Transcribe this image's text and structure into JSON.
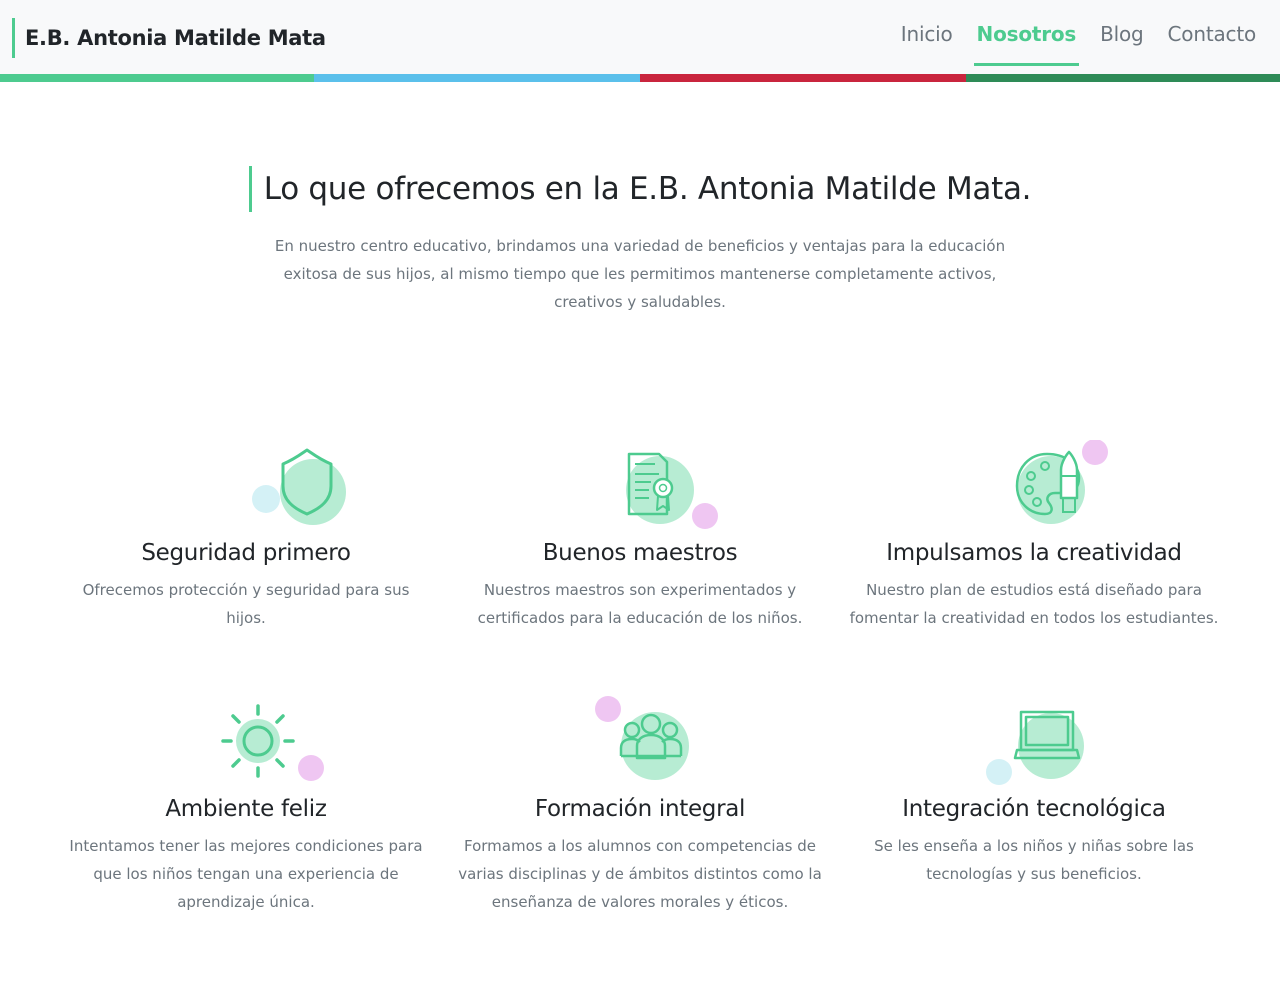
{
  "navbar": {
    "brand": "E.B. Antonia Matilde Mata",
    "links": [
      {
        "label": "Inicio",
        "active": false
      },
      {
        "label": "Nosotros",
        "active": true
      },
      {
        "label": "Blog",
        "active": false
      },
      {
        "label": "Contacto",
        "active": false
      }
    ]
  },
  "colors": {
    "accent": "#4dcb8f",
    "bar": [
      "#4dcb8f",
      "#5bc0eb",
      "#c9253d",
      "#2e8b57"
    ],
    "circle_green": "#b7ecd3",
    "circle_pink": "#efc6f2",
    "circle_blue": "#d4f1f6"
  },
  "section": {
    "title": "Lo que ofrecemos en la E.B. Antonia Matilde Mata.",
    "intro": "En nuestro centro educativo, brindamos una variedad de beneficios y ventajas para la educación exitosa de sus hijos, al mismo tiempo que les permitimos mantenerse completamente activos, creativos y saludables."
  },
  "features": [
    {
      "icon": "shield-icon",
      "title": "Seguridad primero",
      "text": "Ofrecemos protección y seguridad para sus hijos."
    },
    {
      "icon": "certificate-icon",
      "title": "Buenos maestros",
      "text": "Nuestros maestros son experimentados y certificados para la educación de los niños."
    },
    {
      "icon": "palette-icon",
      "title": "Impulsamos la creatividad",
      "text": "Nuestro plan de estudios está diseñado para fomentar la creatividad en todos los estudiantes."
    },
    {
      "icon": "sun-icon",
      "title": "Ambiente feliz",
      "text": "Intentamos tener las mejores condiciones para que los niños tengan una experiencia de aprendizaje única."
    },
    {
      "icon": "group-icon",
      "title": "Formación integral",
      "text": "Formamos a los alumnos con competencias de varias disciplinas y de ámbitos distintos como la enseñanza de valores morales y éticos."
    },
    {
      "icon": "laptop-icon",
      "title": "Integración tecnológica",
      "text": "Se les enseña a los niños y niñas sobre las tecnologías y sus beneficios."
    }
  ]
}
